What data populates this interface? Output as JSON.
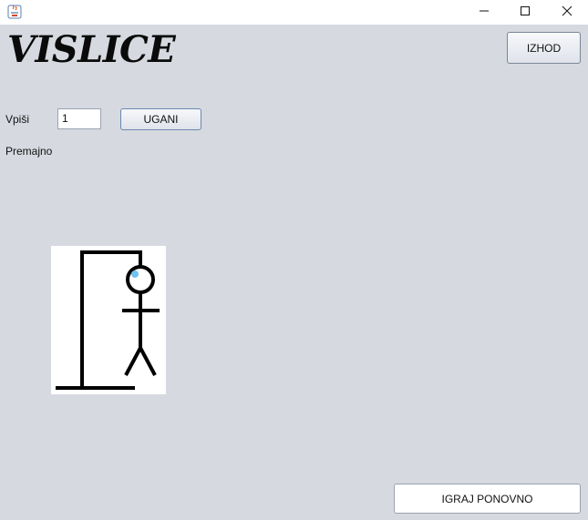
{
  "window": {
    "minimize_icon": "minimize-icon",
    "maximize_icon": "maximize-icon",
    "close_icon": "close-icon",
    "app_icon": "java-icon"
  },
  "game": {
    "title": "VISLICE",
    "exit_label": "IZHOD",
    "input_label": "Vpiši",
    "input_value": "1",
    "guess_label": "UGANI",
    "status": "Premajno",
    "replay_label": "IGRAJ PONOVNO"
  },
  "hangman": {
    "image": "hangman-drawing",
    "colors": {
      "lines": "#000000",
      "highlight": "#6fc3ef"
    }
  }
}
